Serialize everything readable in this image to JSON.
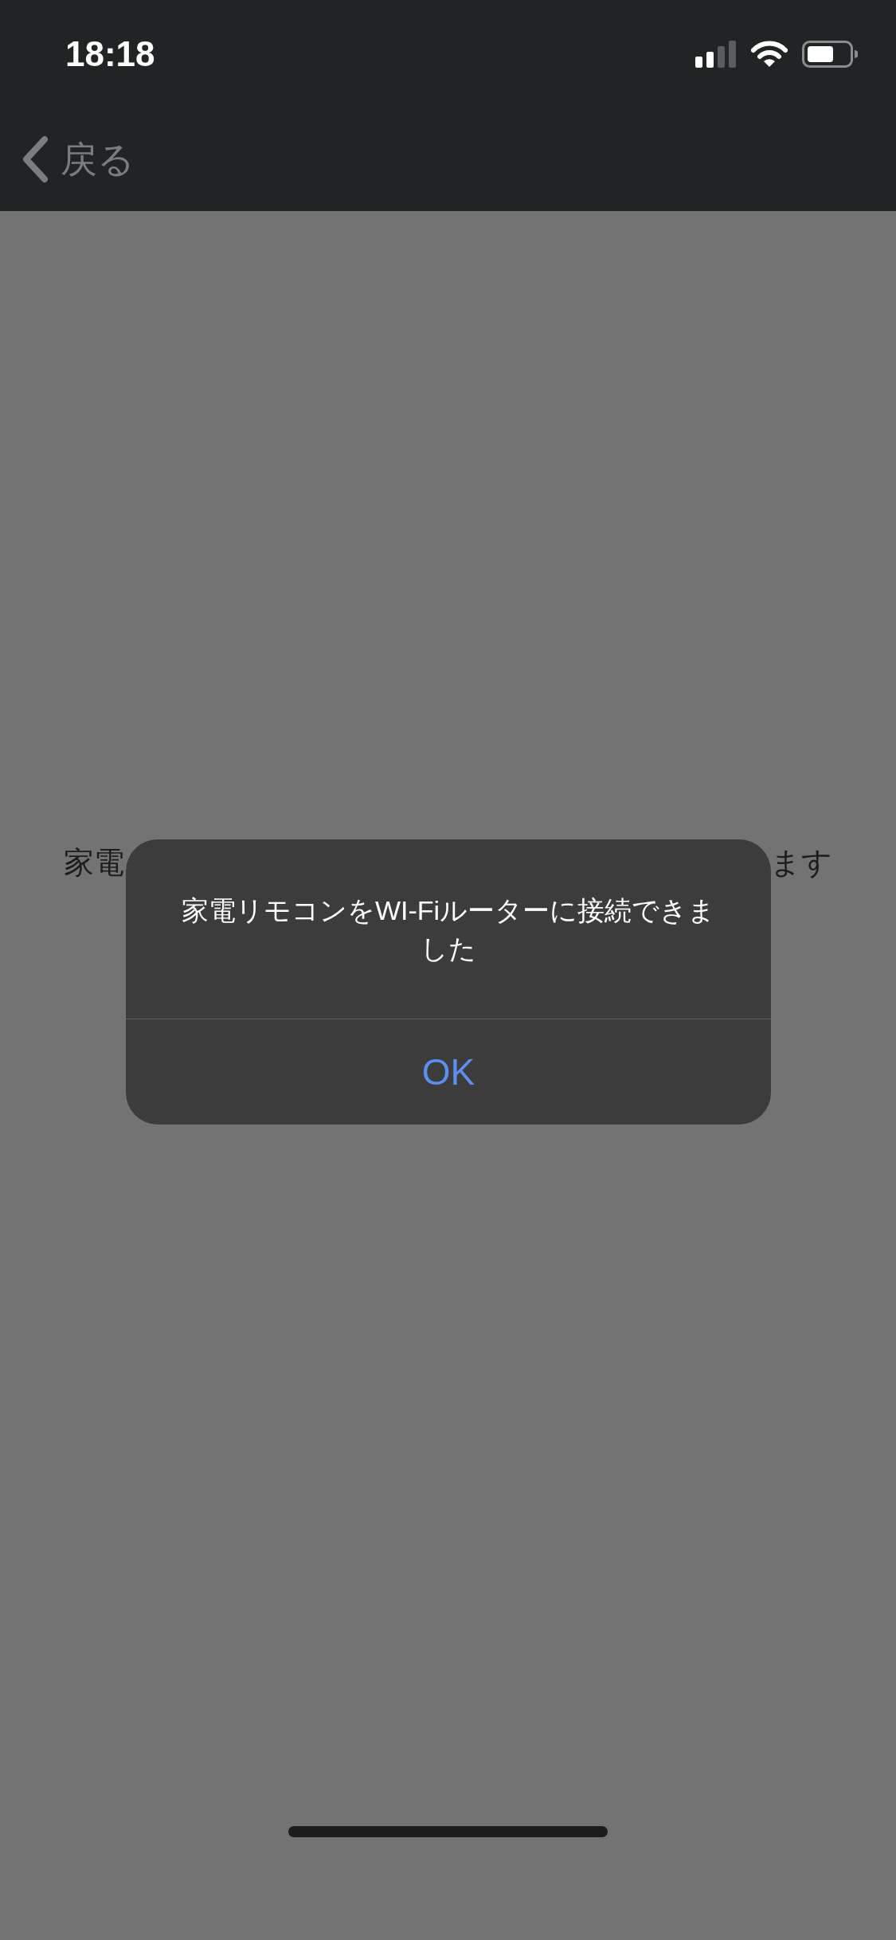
{
  "status_bar": {
    "time": "18:18"
  },
  "nav_bar": {
    "back_label": "戻る"
  },
  "page": {
    "text_left": "家電",
    "text_right": "ます"
  },
  "alert": {
    "message": "家電リモコンをWI-Fiルーターに接続できました",
    "buttons": [
      "OK"
    ]
  }
}
